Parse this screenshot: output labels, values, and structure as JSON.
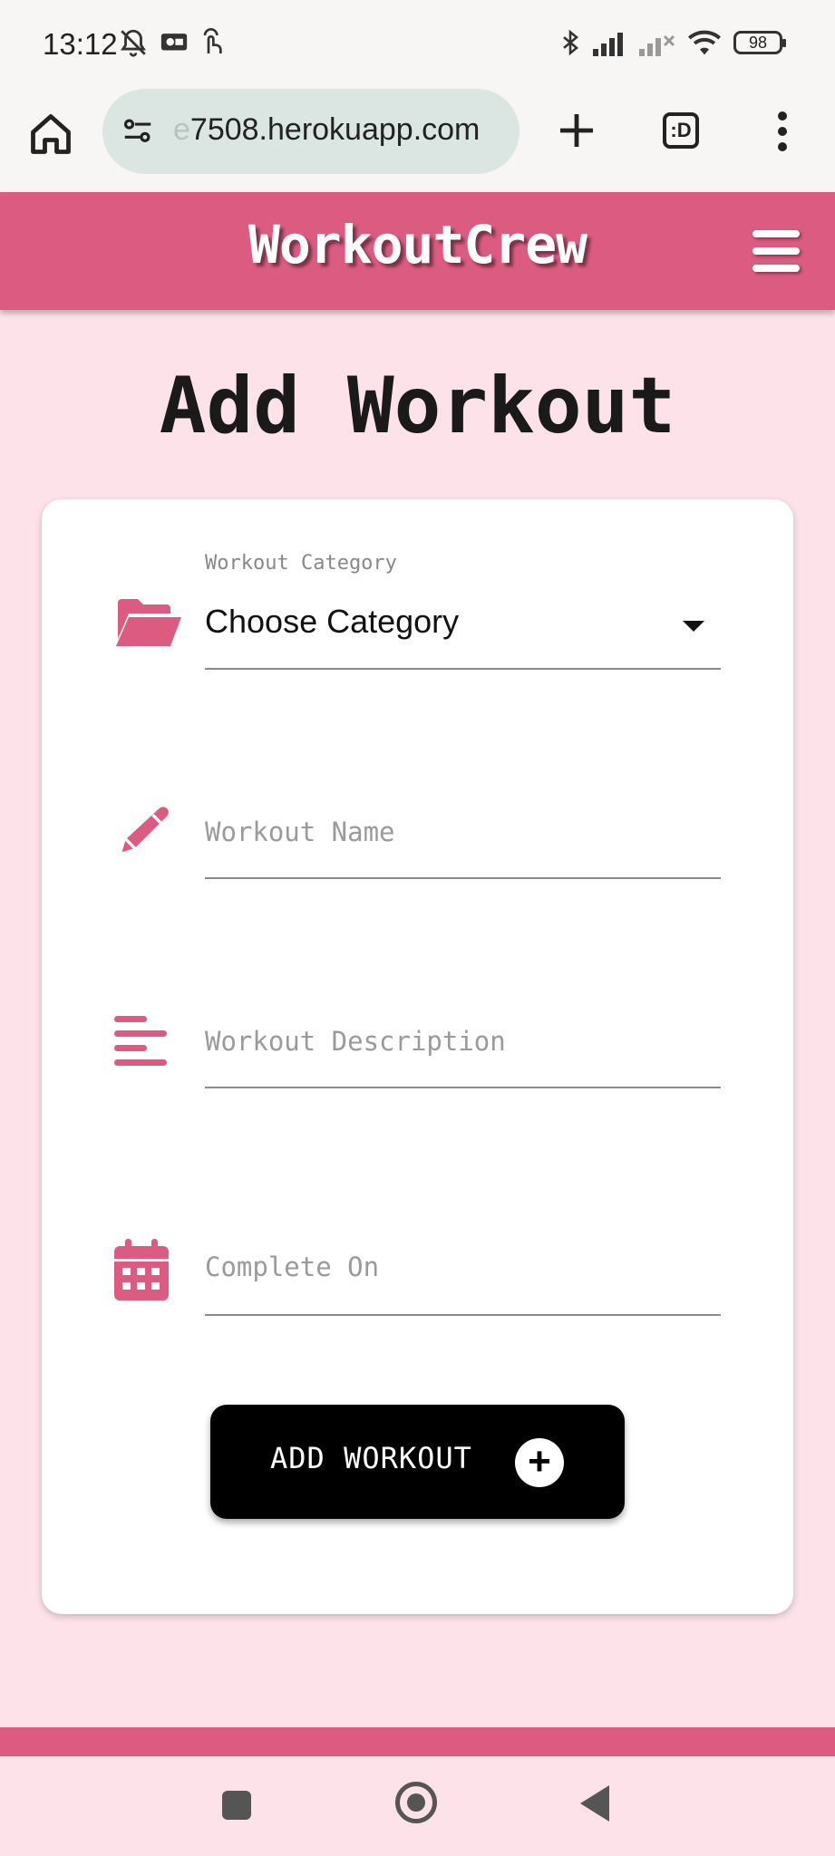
{
  "status_bar": {
    "time": "13:12",
    "battery": "98",
    "icons": [
      "mute-bell-icon",
      "cast-icon",
      "gesture-icon",
      "bluetooth-icon",
      "signal-icon",
      "signal-off-icon",
      "wifi-icon",
      "battery-icon"
    ]
  },
  "browser": {
    "url_faded": "e",
    "url": "7508.herokuapp.com",
    "tabs_label": ":D",
    "icons": [
      "home-icon",
      "site-settings-icon",
      "new-tab-icon",
      "tabs-icon",
      "overflow-menu-icon"
    ]
  },
  "app": {
    "brand": "WorkoutCrew",
    "menu_icon": "hamburger-icon",
    "accent_color": "#db5b81",
    "background_color": "#fde2ea"
  },
  "page": {
    "title": "Add Workout"
  },
  "form": {
    "category": {
      "label": "Workout Category",
      "value": "Choose Category",
      "icon": "folder-open-icon"
    },
    "name": {
      "placeholder": "Workout Name",
      "icon": "pencil-icon"
    },
    "description": {
      "placeholder": "Workout Description",
      "icon": "align-left-icon"
    },
    "complete_on": {
      "placeholder": "Complete On",
      "icon": "calendar-icon"
    },
    "submit": {
      "label": "ADD WORKOUT",
      "icon": "plus-circle-icon",
      "glyph": "+"
    }
  },
  "system_nav": {
    "buttons": [
      "recents-button",
      "home-button",
      "back-button"
    ]
  }
}
